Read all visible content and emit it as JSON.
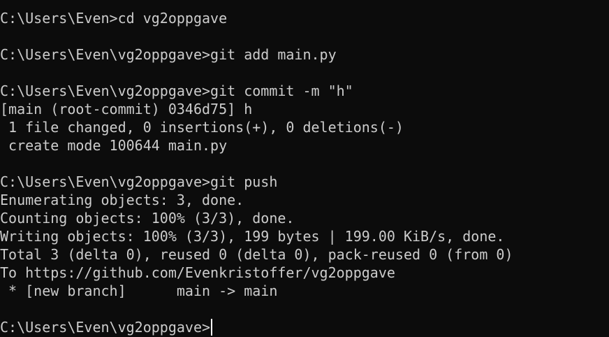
{
  "colors": {
    "background": "#0c0c0c",
    "text": "#cccccc",
    "cursor": "#ffffff"
  },
  "terminal": {
    "lines": [
      "C:\\Users\\Even>cd vg2oppgave",
      "",
      "C:\\Users\\Even\\vg2oppgave>git add main.py",
      "",
      "C:\\Users\\Even\\vg2oppgave>git commit -m \"h\"",
      "[main (root-commit) 0346d75] h",
      " 1 file changed, 0 insertions(+), 0 deletions(-)",
      " create mode 100644 main.py",
      "",
      "C:\\Users\\Even\\vg2oppgave>git push",
      "Enumerating objects: 3, done.",
      "Counting objects: 100% (3/3), done.",
      "Writing objects: 100% (3/3), 199 bytes | 199.00 KiB/s, done.",
      "Total 3 (delta 0), reused 0 (delta 0), pack-reused 0 (from 0)",
      "To https://github.com/Evenkristoffer/vg2oppgave",
      " * [new branch]      main -> main",
      "",
      "C:\\Users\\Even\\vg2oppgave>"
    ]
  }
}
